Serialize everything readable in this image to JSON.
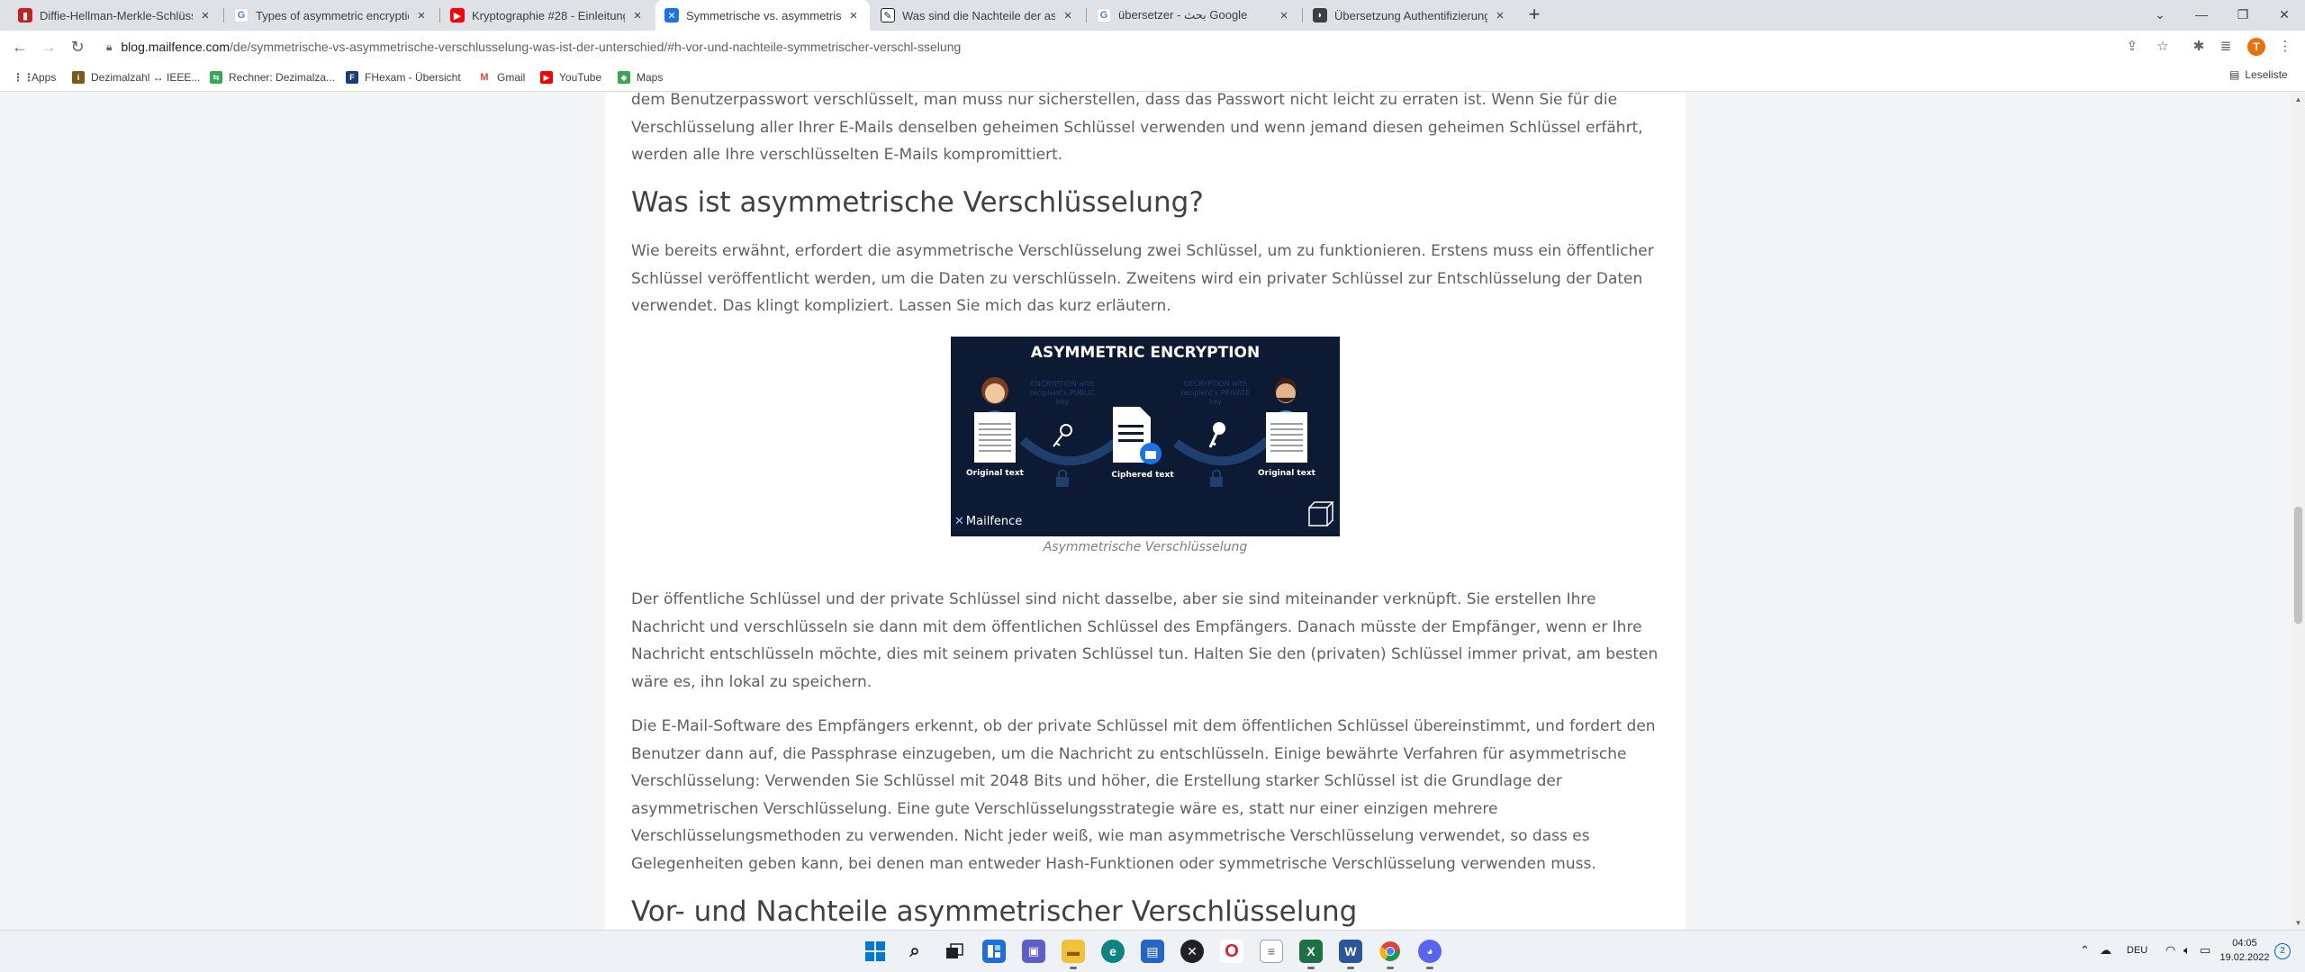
{
  "browser": {
    "tabs": [
      {
        "title": "Diffie-Hellman-Merkle-Schlüssel...",
        "icon": "bookmark-red-icon",
        "color": "#c5221f"
      },
      {
        "title": "Types of asymmetric encryption ...",
        "icon": "google-icon",
        "color": "#4285f4"
      },
      {
        "title": "Kryptographie #28 - Einleitung a...",
        "icon": "youtube-icon",
        "color": "#ff0000"
      },
      {
        "title": "Symmetrische vs. asymmetrische ...",
        "icon": "mailfence-icon",
        "color": "#1a73e8",
        "active": true
      },
      {
        "title": "Was sind die Nachteile der asym...",
        "icon": "edit-icon",
        "color": "#202124"
      },
      {
        "title": "übersetzer - بحث Google",
        "icon": "google-icon",
        "color": "#4285f4"
      },
      {
        "title": "Übersetzung Authentifizierung D...",
        "icon": "dictionary-icon",
        "color": "#3c4043"
      }
    ],
    "url_host": "blog.mailfence.com",
    "url_path": "/de/symmetrische-vs-asymmetrische-verschlusselung-was-ist-der-unterschied/#h-vor-und-nachteile-symmetrischer-verschl-sselung",
    "profile_initial": "T",
    "bookmarks": [
      {
        "label": "Apps",
        "color": "#ea4335"
      },
      {
        "label": "Dezimalzahl ↔ IEEE...",
        "color": "#7a5c1a"
      },
      {
        "label": "Rechner: Dezimalza...",
        "color": "#34a853"
      },
      {
        "label": "FHexam - Übersicht",
        "color": "#1a3d7a"
      },
      {
        "label": "Gmail",
        "color": "#ea4335"
      },
      {
        "label": "YouTube",
        "color": "#ff0000"
      },
      {
        "label": "Maps",
        "color": "#34a853"
      }
    ],
    "reading_list": "Leseliste"
  },
  "article": {
    "p_top": "dem Benutzerpasswort verschlüsselt, man muss nur sicherstellen, dass das Passwort nicht leicht zu erraten ist. Wenn Sie für die Verschlüsselung aller Ihrer E-Mails denselben geheimen Schlüssel verwenden und wenn jemand diesen geheimen Schlüssel erfährt, werden alle Ihre verschlüsselten E-Mails kompromittiert.",
    "h2_asym": "Was ist asymmetrische Verschlüsselung?",
    "p_intro": "Wie bereits erwähnt, erfordert die asymmetrische Verschlüsselung zwei Schlüssel, um zu funktionieren. Erstens muss ein öffentlicher Schlüssel veröffentlicht werden, um die Daten zu verschlüsseln. Zweitens wird ein privater Schlüssel zur Entschlüsselung der Daten verwendet. Das klingt kompliziert. Lassen Sie mich das kurz erläutern.",
    "figure": {
      "title": "ASYMMETRIC ENCRYPTION",
      "enc_label": "ENCRYPTION with recipient's PUBLIC key",
      "dec_label": "DECRYPTION with recipient's PRIVATE key",
      "original_left": "Original text",
      "ciphered": "Ciphered text",
      "original_right": "Original text",
      "brand": "Mailfence"
    },
    "caption": "Asymmetrische Verschlüsselung",
    "p_keys": "Der öffentliche Schlüssel und der private Schlüssel sind nicht dasselbe, aber sie sind miteinander verknüpft. Sie erstellen Ihre Nachricht und verschlüsseln sie dann mit dem öffentlichen Schlüssel des Empfängers. Danach müsste der Empfänger, wenn er Ihre Nachricht entschlüsseln möchte, dies mit seinem privaten Schlüssel tun. Halten Sie den (privaten) Schlüssel immer privat, am besten wäre es, ihn lokal zu speichern.",
    "p_software": "Die E-Mail-Software des Empfängers erkennt, ob der private Schlüssel mit dem öffentlichen Schlüssel übereinstimmt, und fordert den Benutzer dann auf, die Passphrase einzugeben, um die Nachricht zu entschlüsseln. Einige bewährte Verfahren für asymmetrische Verschlüsselung: Verwenden Sie Schlüssel mit 2048 Bits und höher, die Erstellung starker Schlüssel ist die Grundlage der asymmetrischen Verschlüsselung. Eine gute Verschlüsselungsstrategie wäre es, statt nur einer einzigen mehrere Verschlüsselungsmethoden zu verwenden. Nicht jeder weiß, wie man asymmetrische Verschlüsselung verwendet, so dass es Gelegenheiten geben kann, bei denen man entweder Hash-Funktionen oder symmetrische Verschlüsselung verwenden muss.",
    "h2_pros": "Vor- und Nachteile asymmetrischer Verschlüsselung"
  },
  "taskbar": {
    "apps": [
      {
        "name": "start-icon",
        "color": "#0078d4"
      },
      {
        "name": "search-icon",
        "color": "#202124"
      },
      {
        "name": "task-view-icon",
        "color": "#202124"
      },
      {
        "name": "widgets-icon",
        "color": "#1e6fd9"
      },
      {
        "name": "teams-chat-icon",
        "color": "#5b5fc7"
      },
      {
        "name": "file-explorer-icon",
        "color": "#f3c03a"
      },
      {
        "name": "edge-icon",
        "color": "#0c8484"
      },
      {
        "name": "store-icon",
        "color": "#2764c8"
      },
      {
        "name": "xbox-icon",
        "color": "#202124"
      },
      {
        "name": "opera-icon",
        "color": "#e21f26"
      },
      {
        "name": "notepad-icon",
        "color": "#e8eaed"
      },
      {
        "name": "excel-icon",
        "color": "#1e7145"
      },
      {
        "name": "word-icon",
        "color": "#2b579a"
      },
      {
        "name": "chrome-icon",
        "color": "#ffffff"
      },
      {
        "name": "discord-icon",
        "color": "#5865f2"
      }
    ],
    "lang": "DEU",
    "time": "04:05",
    "date": "19.02.2022",
    "notifications": "2"
  }
}
